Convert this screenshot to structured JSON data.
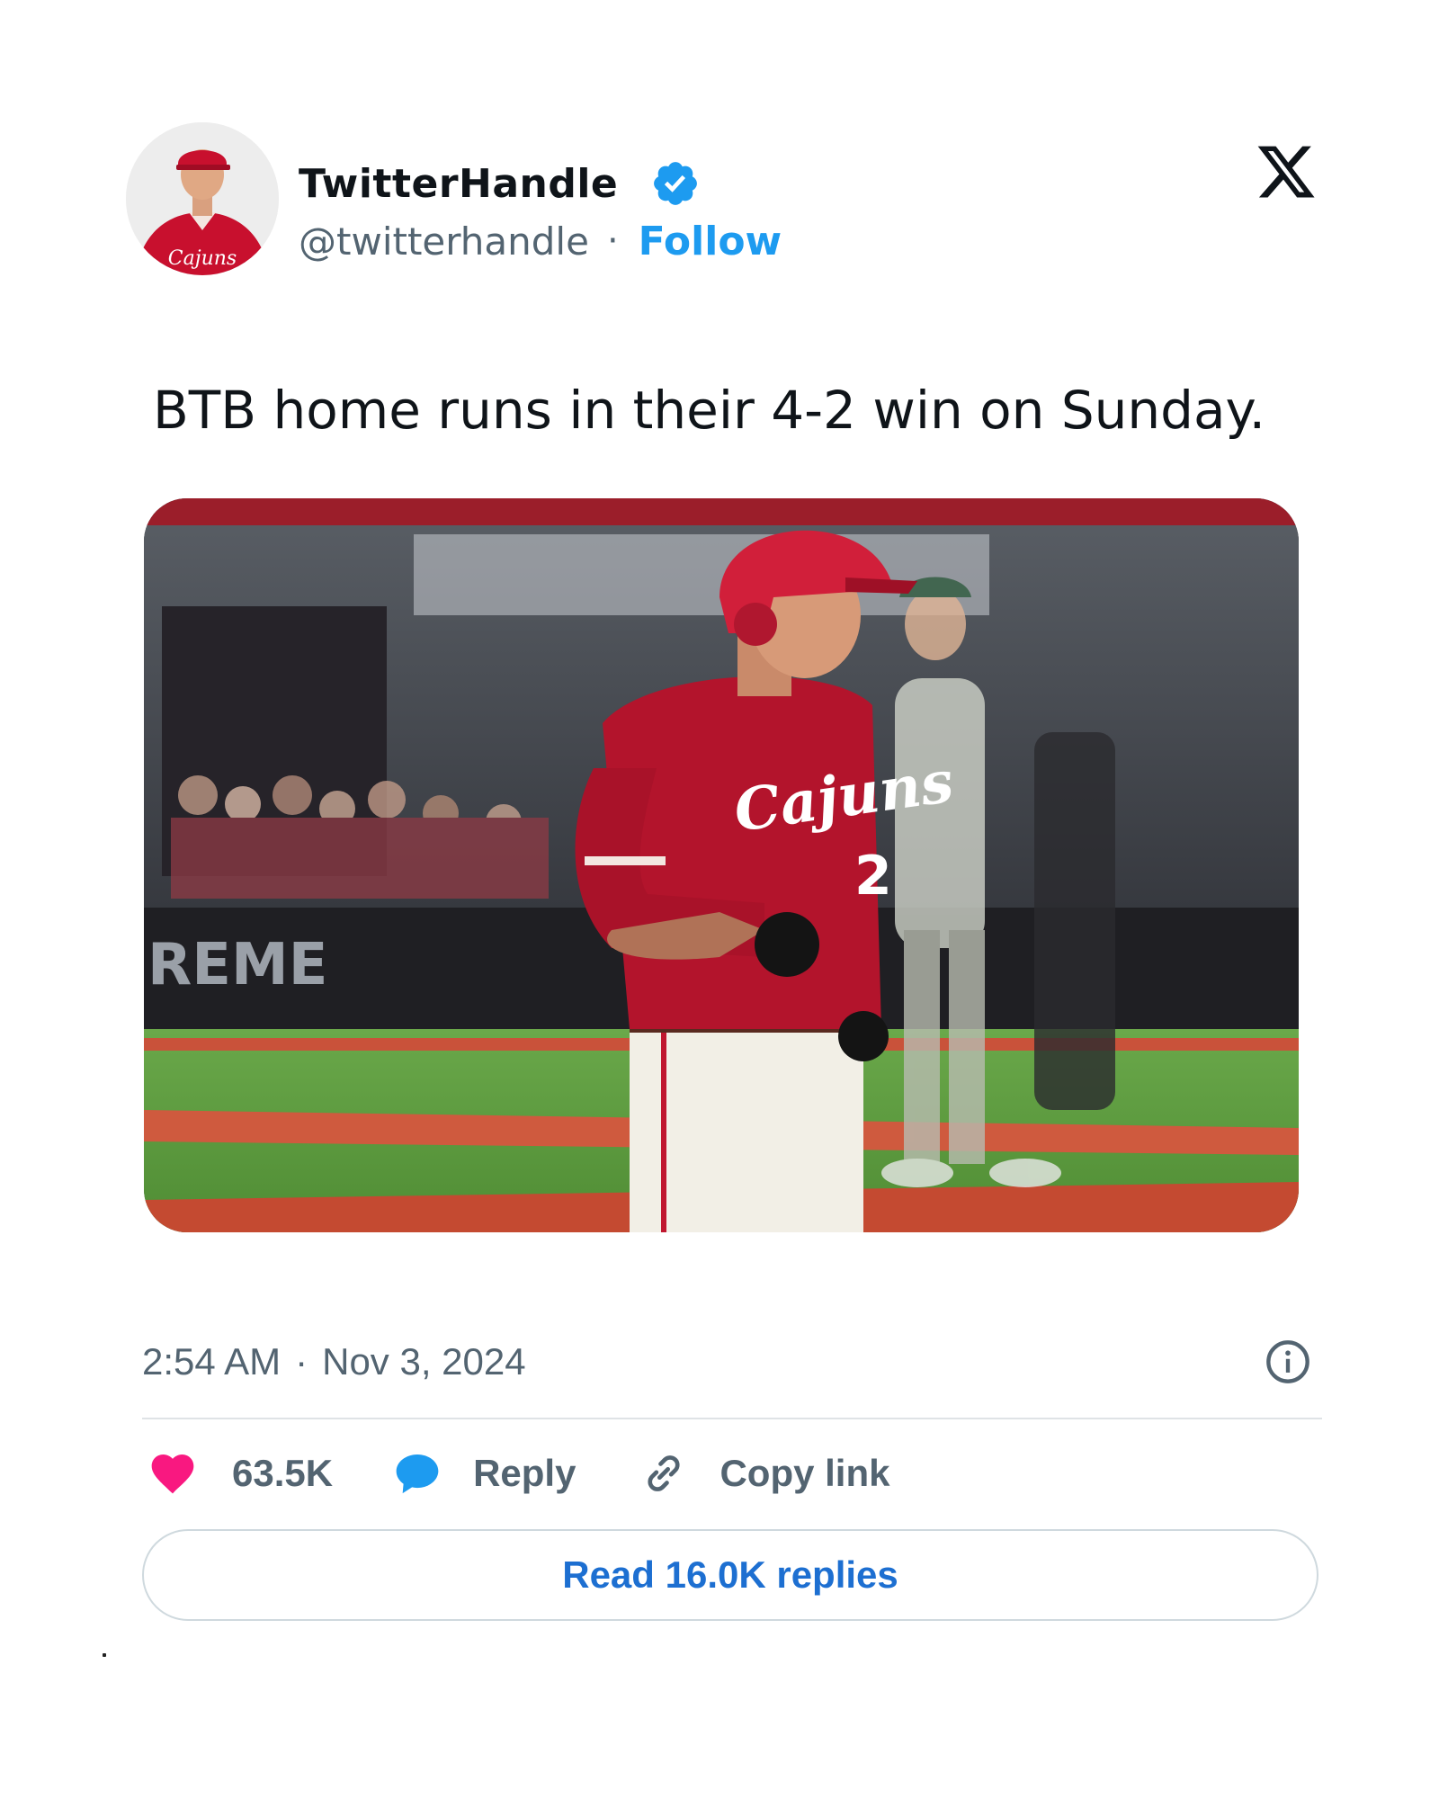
{
  "author": {
    "display_name": "TwitterHandle",
    "handle": "@twitterhandle",
    "separator": "·",
    "follow_label": "Follow",
    "verified": true,
    "avatar_jersey_text": "Cajuns"
  },
  "platform_icon": "x-logo-icon",
  "tweet": {
    "text": "BTB home runs in their 4-2 win on Sunday."
  },
  "media": {
    "jersey_text": "Cajuns",
    "wall_text": "REME"
  },
  "meta": {
    "time": "2:54 AM",
    "separator": "·",
    "date": "Nov 3, 2024"
  },
  "actions": {
    "likes": "63.5K",
    "reply_label": "Reply",
    "copy_label": "Copy link"
  },
  "read_replies_label": "Read 16.0K replies",
  "colors": {
    "accent": "#1d9bf0",
    "heart": "#f91880",
    "reply_bubble": "#1d9bf0",
    "replies_text": "#1d6fd1",
    "muted": "#536471"
  }
}
